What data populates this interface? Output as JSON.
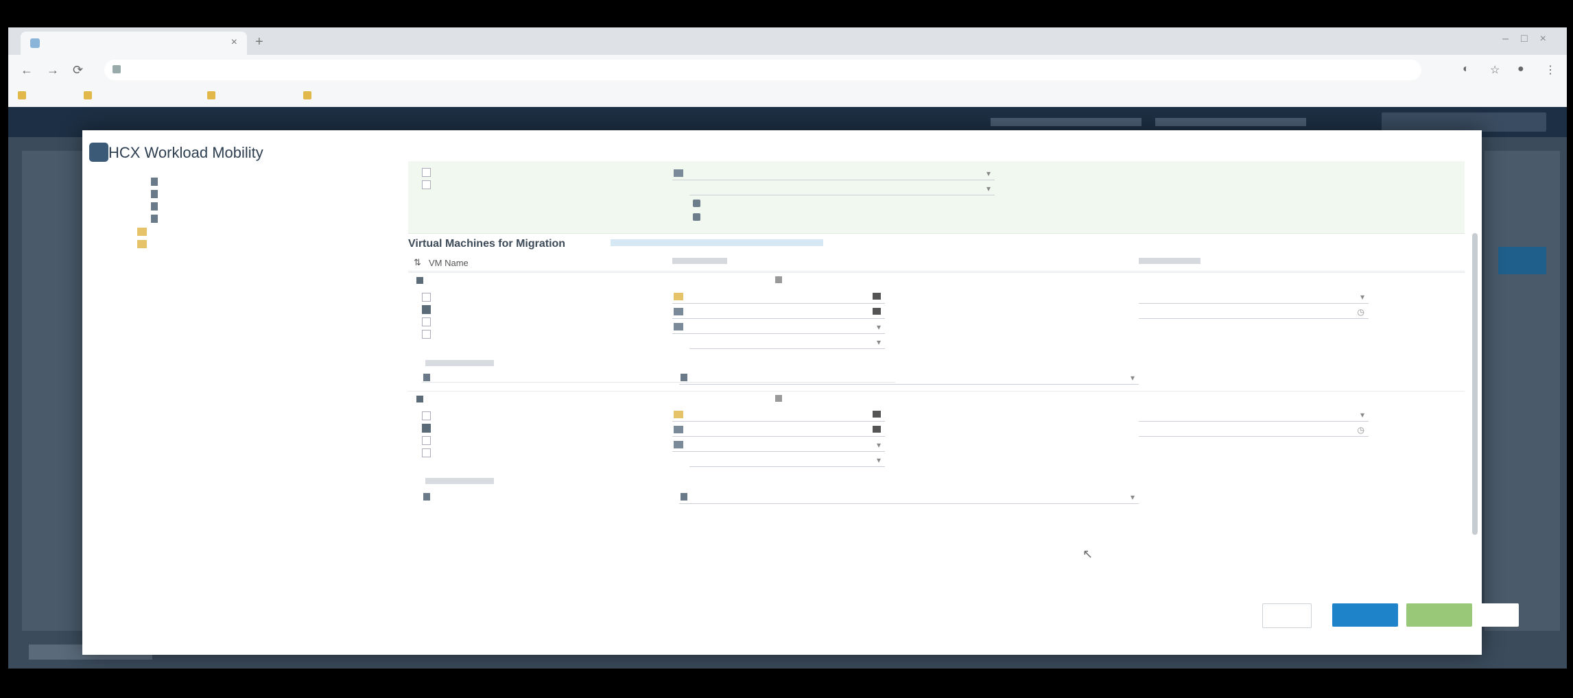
{
  "browser": {
    "tab_title": "",
    "address": "",
    "bookmarks": [
      "",
      "",
      "",
      ""
    ]
  },
  "modal": {
    "title": "HCX Workload Mobility"
  },
  "tree": {
    "items": [
      "",
      "",
      "",
      "",
      "",
      ""
    ]
  },
  "sections": {
    "vm_migration_title": "Virtual Machines for Migration",
    "columns": [
      "VM Name",
      "",
      ""
    ]
  },
  "vm_rows": [
    {
      "name": "",
      "options": [
        "",
        "",
        "",
        ""
      ],
      "stats": ""
    },
    {
      "name": "",
      "options": [
        "",
        "",
        "",
        ""
      ],
      "stats": ""
    }
  ],
  "buttons": {
    "cancel": "",
    "back": "",
    "next": "",
    "finish": ""
  }
}
